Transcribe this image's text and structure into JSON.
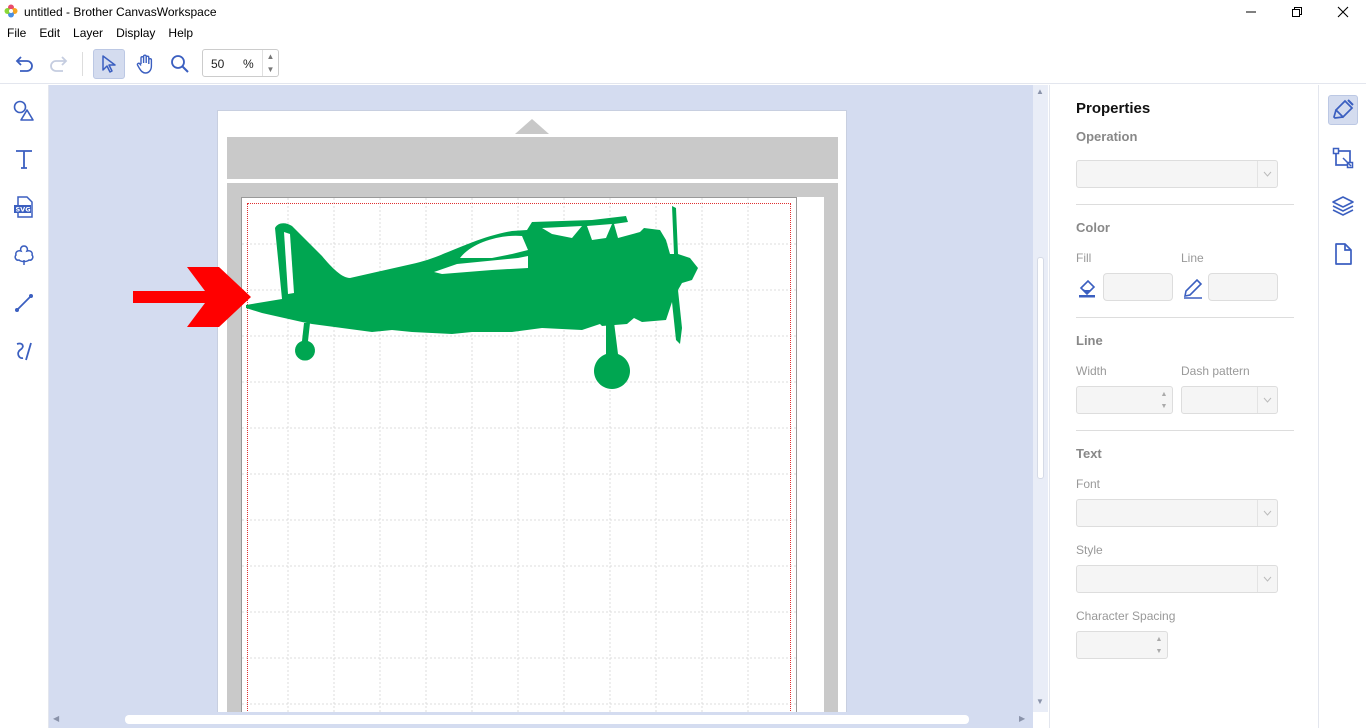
{
  "window": {
    "title": "untitled - Brother CanvasWorkspace",
    "controls": [
      "minimize",
      "restore",
      "close"
    ]
  },
  "menu": [
    "File",
    "Edit",
    "Layer",
    "Display",
    "Help"
  ],
  "toolbar": {
    "undo": "undo-icon",
    "redo": "redo-icon",
    "select": "pointer-icon",
    "pan": "hand-icon",
    "zoom": "magnifier-icon",
    "zoom_value": "50",
    "zoom_unit": "%"
  },
  "left_tools": [
    "shapes-icon",
    "text-icon",
    "svg-import-icon",
    "pattern-icon",
    "line-icon",
    "freehand-icon"
  ],
  "canvas": {
    "object": "airplane-silhouette",
    "object_color": "#00a651",
    "annotation": "red-arrow"
  },
  "properties": {
    "title": "Properties",
    "operation_label": "Operation",
    "color_label": "Color",
    "fill_label": "Fill",
    "line_sub_label": "Line",
    "line_section_label": "Line",
    "width_label": "Width",
    "dash_label": "Dash pattern",
    "text_label": "Text",
    "font_label": "Font",
    "style_label": "Style",
    "spacing_label": "Character Spacing"
  },
  "rail": [
    "brush-icon",
    "transform-icon",
    "layers-icon",
    "page-icon"
  ],
  "colors": {
    "accent": "#3b5fc0",
    "canvas_bg": "#d4dcf0",
    "plane": "#00a651",
    "arrow": "#ff0000"
  }
}
